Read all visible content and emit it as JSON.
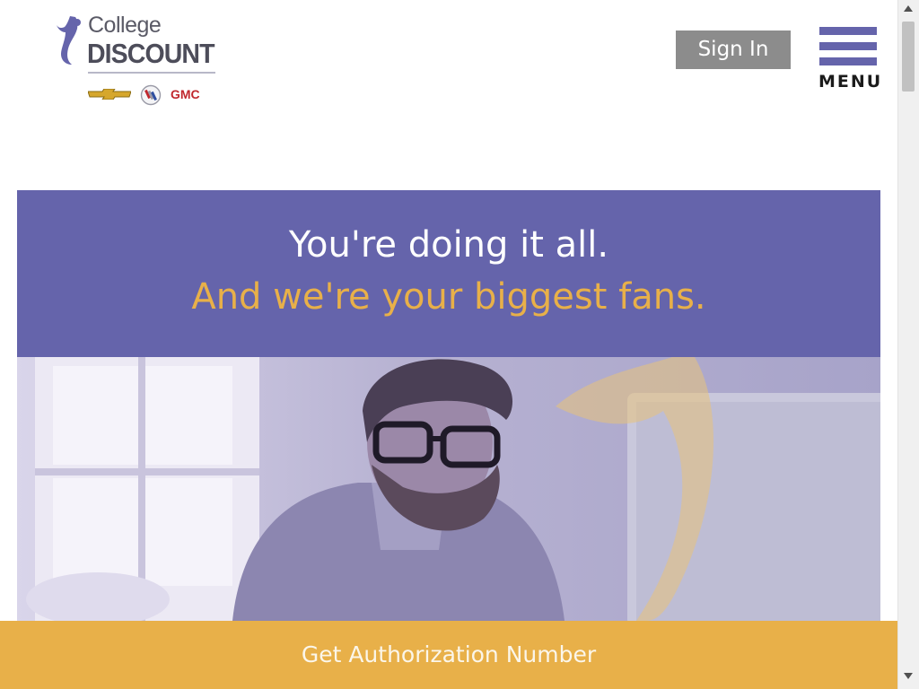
{
  "header": {
    "logo": {
      "line1": "College",
      "line2": "DISCOUNT",
      "brands": {
        "gmc": "GMC"
      }
    },
    "sign_in_label": "Sign In",
    "menu_label": "MENU"
  },
  "hero": {
    "headline": "You're doing it all.",
    "subheadline": "And we're your biggest fans."
  },
  "cta": {
    "label": "Get Authorization Number"
  },
  "colors": {
    "brand_purple": "#6564ab",
    "brand_gold": "#e8b049",
    "sign_in_bg": "#8c8c8c",
    "gmc_red": "#c0272d"
  }
}
